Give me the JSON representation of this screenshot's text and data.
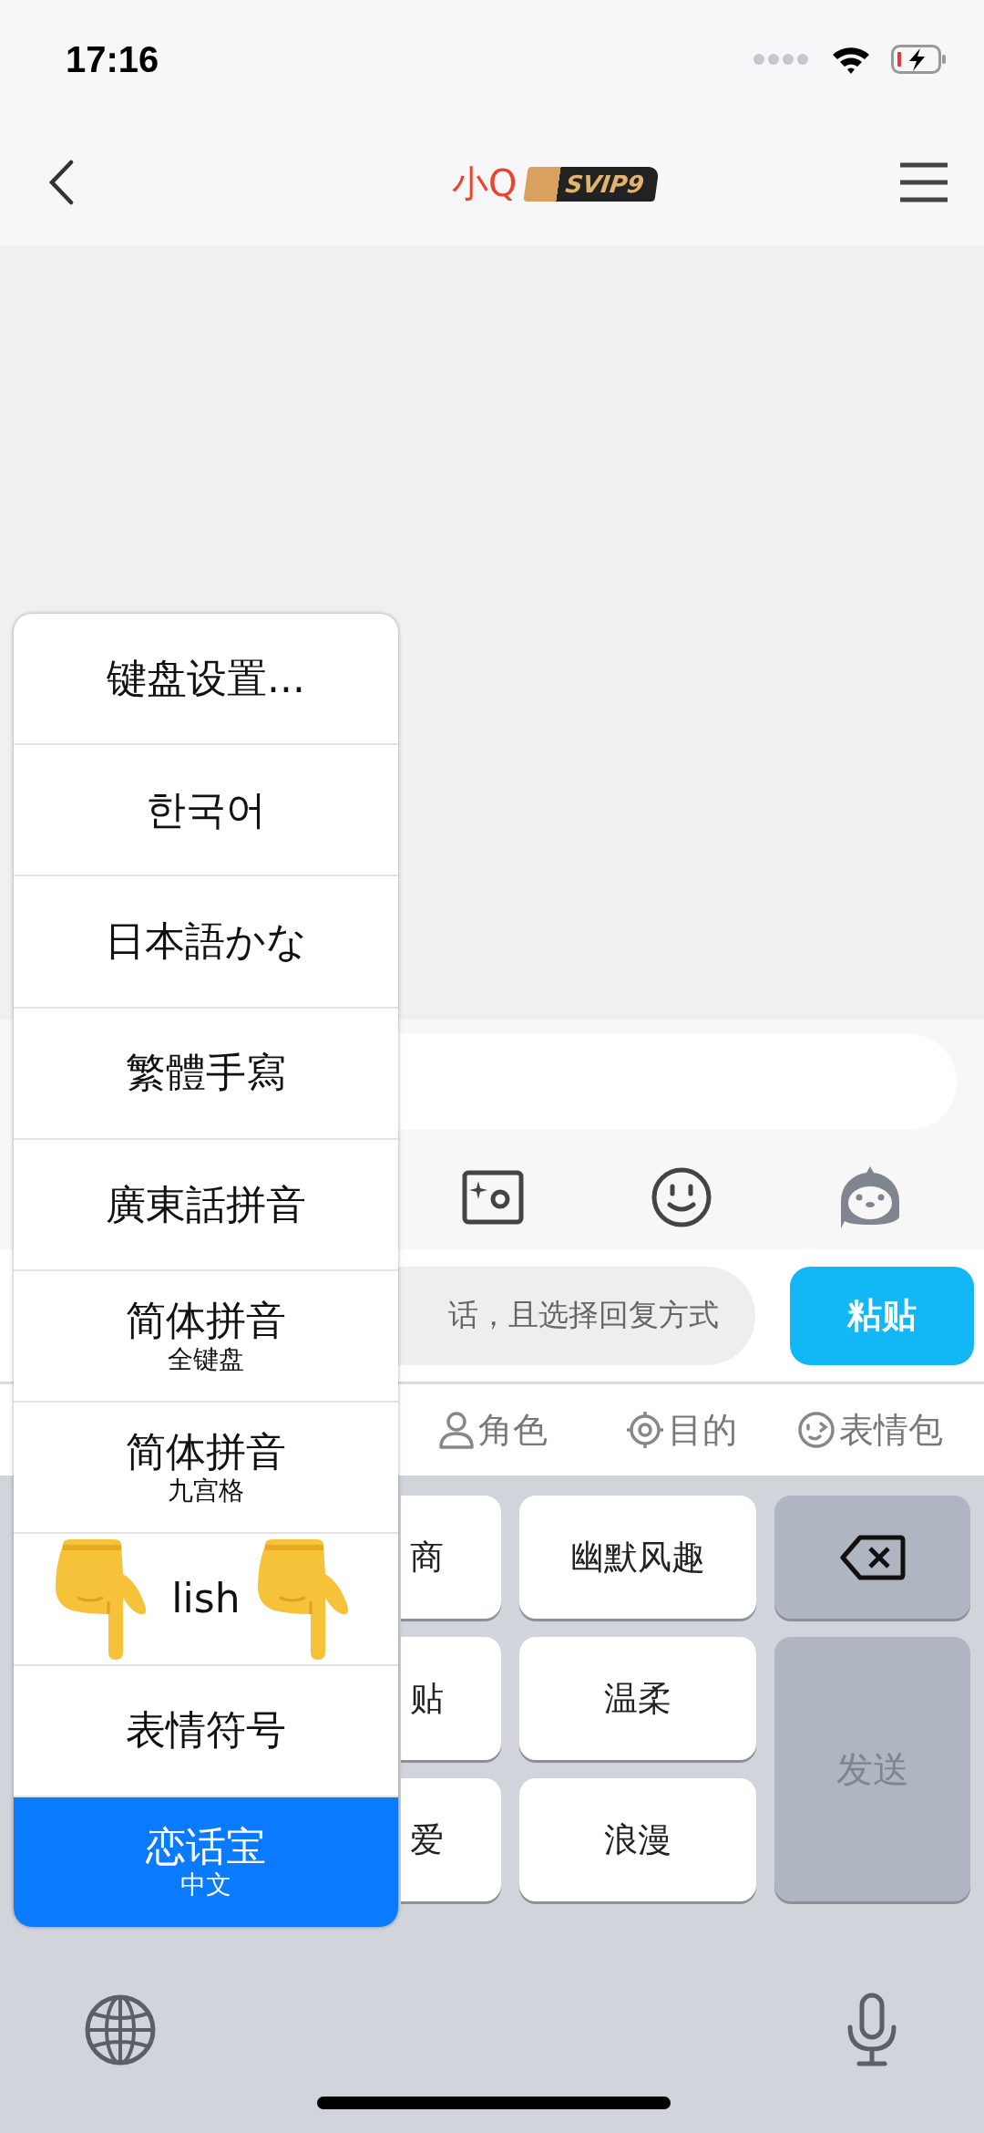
{
  "status_bar": {
    "time": "17:16"
  },
  "nav": {
    "title": "小Q",
    "badge": "SVIP9"
  },
  "quick_reply": {
    "text": "话，且选择回复方式",
    "button": "粘贴"
  },
  "tabs": [
    {
      "label": "角色",
      "kind": "person"
    },
    {
      "label": "目的",
      "kind": "target"
    },
    {
      "label": "表情包",
      "kind": "wink"
    }
  ],
  "key_grid": {
    "columns": [
      [
        "商",
        "贴",
        "爱"
      ],
      [
        "幽默风趣",
        "温柔",
        "浪漫"
      ]
    ]
  },
  "send_key": {
    "label": "发送",
    "disabled": true
  },
  "menu": {
    "items": [
      {
        "label": "键盘设置...",
        "selected": false
      },
      {
        "label": "한국어",
        "selected": false
      },
      {
        "label": "日本語かな",
        "selected": false
      },
      {
        "label": "繁體手寫",
        "selected": false
      },
      {
        "label": "廣東話拼音",
        "selected": false
      },
      {
        "label": "简体拼音",
        "sublabel": "全键盘",
        "selected": false
      },
      {
        "label": "简体拼音",
        "sublabel": "九宫格",
        "selected": false
      },
      {
        "label": "lish",
        "selected": false,
        "covered": true
      },
      {
        "label": "表情符号",
        "selected": false
      },
      {
        "label": "恋话宝",
        "sublabel": "中文",
        "selected": true
      }
    ]
  }
}
